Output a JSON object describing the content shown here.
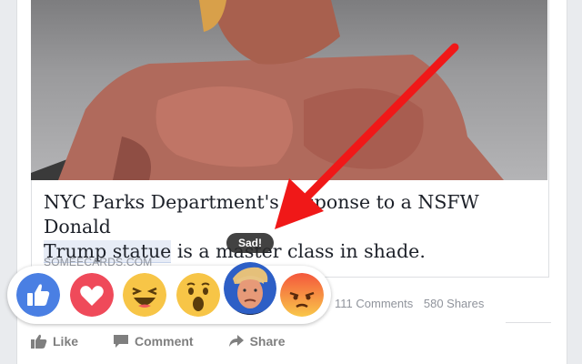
{
  "post": {
    "headline_part1": "NYC Parks Department's response to a NSFW Donald",
    "headline_highlight": "Trump statue",
    "headline_part2": " is a master class in shade.",
    "domain": "SOMEECARDS.COM"
  },
  "stats": {
    "comments": "111 Comments",
    "shares": "580 Shares"
  },
  "actions": {
    "like": "Like",
    "comment": "Comment",
    "share": "Share"
  },
  "reactions": {
    "tooltip": "Sad!",
    "items": [
      "like-icon",
      "love-icon",
      "haha-icon",
      "wow-icon",
      "trump-face-sad-icon",
      "angry-icon"
    ]
  },
  "colors": {
    "like_blue": "#4a7fe3",
    "love_red": "#ef4a5a",
    "emoji_yellow": "#f7c547",
    "angry_orange": "#f47f3a",
    "arrow_red": "#f01818"
  }
}
